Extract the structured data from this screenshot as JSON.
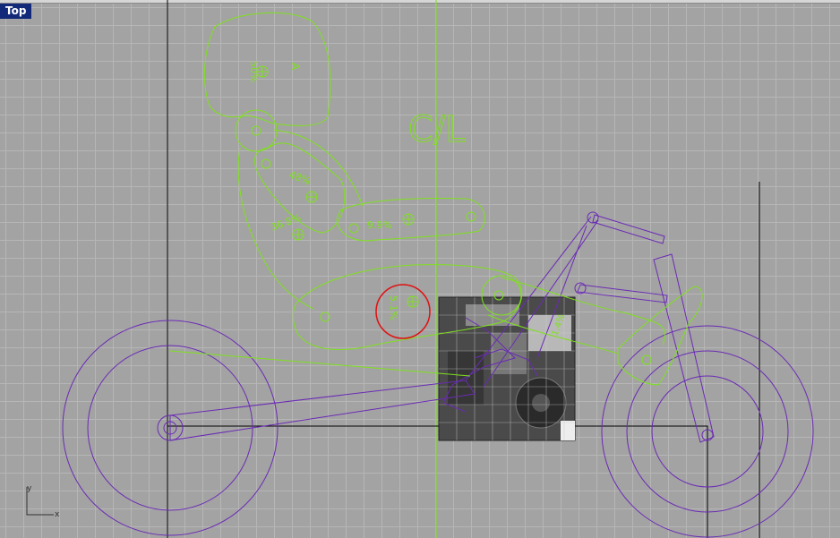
{
  "viewport": {
    "name": "Top",
    "axis_x": "x",
    "axis_y": "y"
  },
  "annotations": {
    "centerline": "C/L",
    "pct_head": "50%",
    "pct_torso": "48%",
    "pct_hip": "36.8%",
    "pct_thigh": "9.9%",
    "pct_shin": "5.1%",
    "pct_foot": "1.4%",
    "marker_a": "A"
  },
  "colors": {
    "viewport_bg": "#a3a3a3",
    "grid": "#b6b6b6",
    "figure": "#7fe01e",
    "bike": "#6a2bb5",
    "selection": "#e01010",
    "label_bg": "#12297a"
  },
  "icons": [
    "axis-widget-icon",
    "mass-center-icon"
  ]
}
